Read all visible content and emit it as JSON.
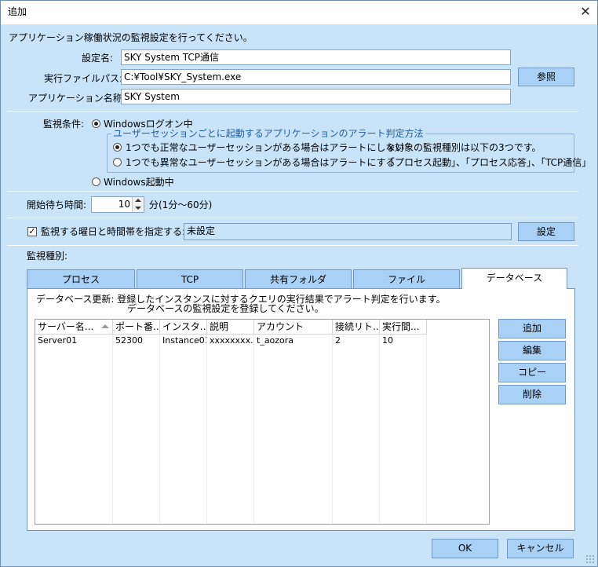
{
  "window": {
    "title": "追加",
    "close_icon": "✕"
  },
  "intro_text": "アプリケーション稼働状況の監視設定を行ってください。",
  "fields": {
    "setting_name_label": "設定名:",
    "setting_name_value": "SKY System TCP通信",
    "exe_path_label": "実行ファイルパス:",
    "exe_path_value": "C:¥Tool¥SKY_System.exe",
    "browse_button": "参照",
    "app_name_label": "アプリケーション名称:",
    "app_name_value": "SKY System"
  },
  "monitor_condition": {
    "label": "監視条件:",
    "option_windows_logon": "Windowsログオン中",
    "group_title": "ユーザーセッションごとに起動するアプリケーションのアラート判定方法",
    "option_normal_session": "1つでも正常なユーザーセッションがある場合はアラートにしない",
    "option_abnormal_session": "1つでも異常なユーザーセッションがある場合はアラートにする",
    "note_line1": "※対象の監視種別は以下の3つです。",
    "note_line2": "「プロセス起動」、「プロセス応答」、「TCP通信」",
    "option_windows_start": "Windows起動中"
  },
  "start_wait": {
    "label": "開始待ち時間:",
    "value": "10",
    "unit": "分(1分～60分)"
  },
  "schedule": {
    "checkbox_label": "監視する曜日と時間帯を指定する:",
    "value": "未設定",
    "button": "設定"
  },
  "monitor_type": {
    "label": "監視種別:",
    "tabs": [
      {
        "label": "プロセス"
      },
      {
        "label": "TCP"
      },
      {
        "label": "共有フォルダ"
      },
      {
        "label": "ファイル"
      },
      {
        "label": "データベース"
      }
    ]
  },
  "database_panel": {
    "desc_line1": "データベース更新: 登録したインスタンスに対するクエリの実行結果でアラート判定を行います。",
    "desc_line2": "データベースの監視設定を登録してください。",
    "columns": [
      "サーバー名...",
      "ポート番...",
      "インスタ...",
      "説明",
      "アカウント",
      "接続リト...",
      "実行間..."
    ],
    "rows": [
      [
        "Server01",
        "52300",
        "Instance01",
        "xxxxxxxx...",
        "t_aozora",
        "2",
        "10"
      ]
    ],
    "buttons": {
      "add": "追加",
      "edit": "編集",
      "copy": "コピー",
      "delete": "削除"
    }
  },
  "footer": {
    "ok": "OK",
    "cancel": "キャンセル"
  },
  "colors": {
    "dialog_bg": "#c9e3f9",
    "button_bg": "#a9d1f5",
    "border": "#6f99c4",
    "group_title": "#1c5fa8"
  }
}
